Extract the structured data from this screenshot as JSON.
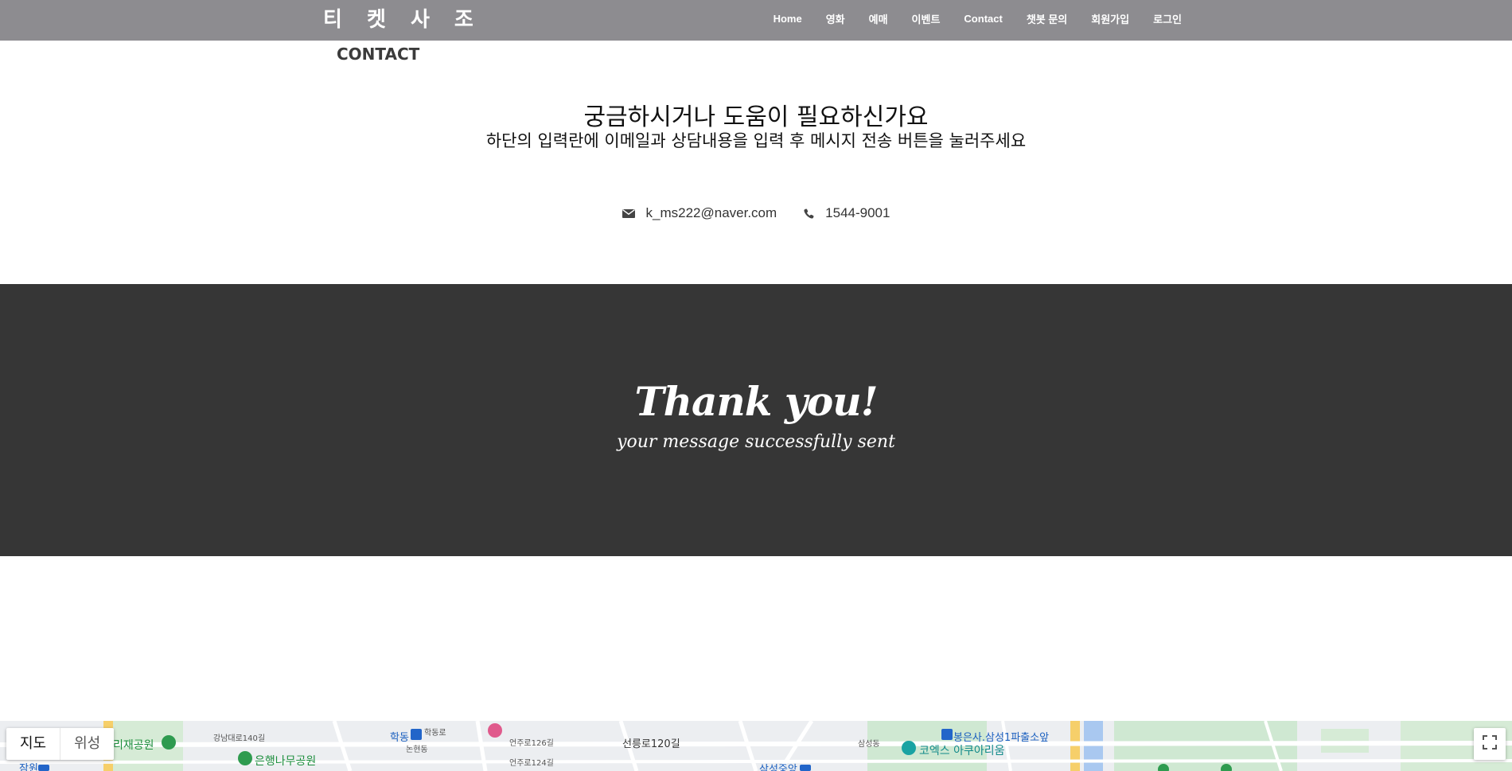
{
  "navbar": {
    "brand": "티 켓 사 조",
    "items": [
      {
        "label": "Home"
      },
      {
        "label": "영화"
      },
      {
        "label": "예매"
      },
      {
        "label": "이벤트"
      },
      {
        "label": "Contact"
      },
      {
        "label": "챗봇 문의"
      },
      {
        "label": "회원가입"
      },
      {
        "label": "로그인"
      }
    ]
  },
  "page": {
    "heading": "CONTACT"
  },
  "intro": {
    "title": "궁금하시거나 도움이 필요하신가요",
    "subtitle": "하단의 입력란에 이메일과 상담내용을 입력 후 메시지 전송 버튼을 눌러주세요"
  },
  "contact": {
    "email": "k_ms222@naver.com",
    "phone": "1544-9001",
    "email_icon": "envelope-icon",
    "phone_icon": "phone-icon"
  },
  "thanks": {
    "title": "Thank you!",
    "subtitle": "your message successfully sent"
  },
  "map": {
    "type_map": "지도",
    "type_satellite": "위성",
    "fullscreen_icon": "fullscreen-icon",
    "labels": {
      "park1": "리재공원",
      "park2": "은행나무공원",
      "station1": "학동",
      "area1": "학동로",
      "area2": "논현동",
      "road1": "강남대로140길",
      "road2": "언주로126길",
      "road3": "언주로124길",
      "road4": "선릉로120길",
      "area3": "삼성동",
      "station2": "봉은사.삼성1파출소앞",
      "aquarium": "코엑스 아쿠아리움",
      "station3": "삼성중앙",
      "station4": "잠원"
    }
  },
  "colors": {
    "navbar_bg": "#8d8c90",
    "band_bg": "#363636",
    "text_dark": "#111111"
  }
}
